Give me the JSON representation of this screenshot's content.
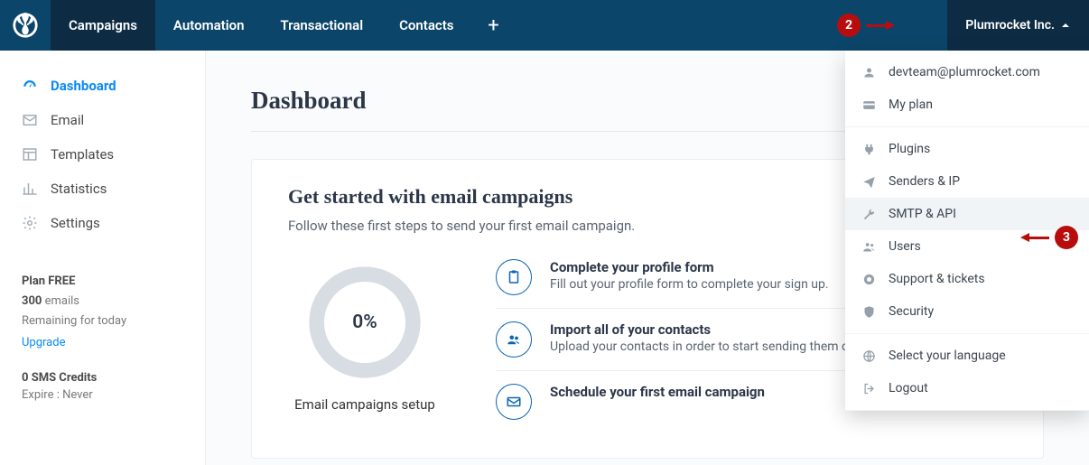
{
  "topnav": {
    "items": [
      "Campaigns",
      "Automation",
      "Transactional",
      "Contacts"
    ],
    "profile_label": "Plumrocket Inc."
  },
  "sidebar": {
    "items": [
      {
        "label": "Dashboard"
      },
      {
        "label": "Email"
      },
      {
        "label": "Templates"
      },
      {
        "label": "Statistics"
      },
      {
        "label": "Settings"
      }
    ],
    "plan": {
      "title": "Plan FREE",
      "emails_count": "300",
      "emails_label": " emails",
      "remaining": "Remaining for today",
      "upgrade": "Upgrade"
    },
    "credits": {
      "title": "0 SMS Credits",
      "expire": "Expire : Never"
    }
  },
  "content": {
    "page_title": "Dashboard",
    "panel": {
      "title": "Get started with email campaigns",
      "subtitle": "Follow these first steps to send your first email campaign.",
      "progress_percent": "0%",
      "progress_caption": "Email campaigns setup",
      "steps": [
        {
          "title": "Complete your profile form",
          "desc": "Fill out your profile form to complete your sign up."
        },
        {
          "title": "Import all of your contacts",
          "desc": "Upload your contacts in order to start sending them campaigns."
        },
        {
          "title": "Schedule your first email campaign",
          "desc": ""
        }
      ]
    }
  },
  "dropdown": {
    "section1": [
      {
        "label": "devteam@plumrocket.com"
      },
      {
        "label": "My plan"
      }
    ],
    "section2": [
      {
        "label": "Plugins"
      },
      {
        "label": "Senders & IP"
      },
      {
        "label": "SMTP & API"
      },
      {
        "label": "Users"
      },
      {
        "label": "Support & tickets"
      },
      {
        "label": "Security"
      }
    ],
    "section3": [
      {
        "label": "Select your language"
      },
      {
        "label": "Logout"
      }
    ]
  },
  "annotations": {
    "badge2": "2",
    "badge3": "3"
  }
}
